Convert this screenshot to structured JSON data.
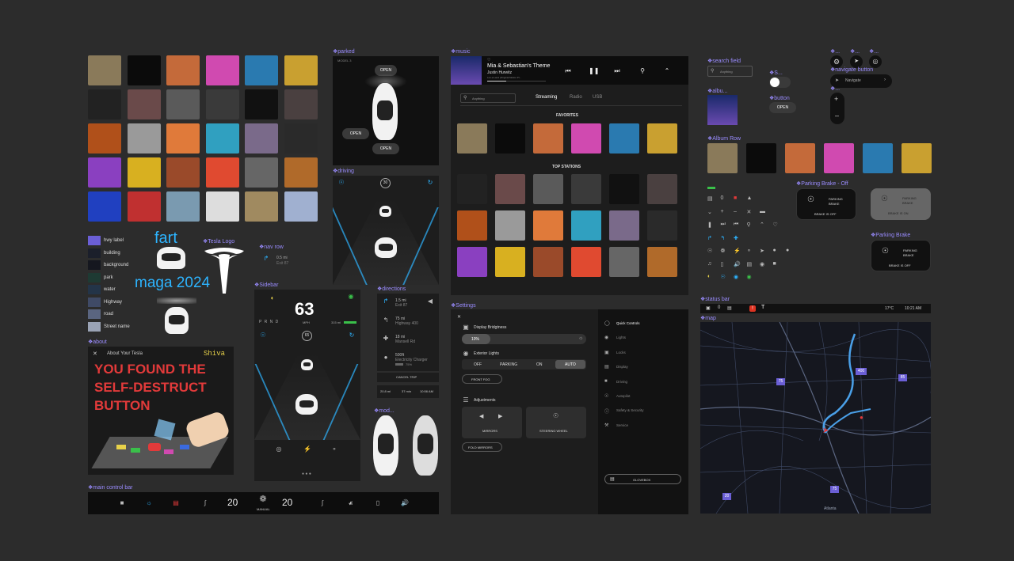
{
  "labels": {
    "parked": "parked",
    "driving": "driving",
    "music": "music",
    "sidebar": "Sidebar",
    "directions": "directions",
    "settings": "Settings",
    "about": "about",
    "main_control_bar": "main control bar",
    "tesla_logo": "Tesla Logo",
    "nav_row": "nav row",
    "modes": "mod...",
    "search_field": "search field",
    "album": "albu...",
    "album_row": "Album Row",
    "switch": "S...",
    "button": "button",
    "navigate_button": "navigate button",
    "parking_brake_off": "Parking Brake - Off",
    "parking_brake": "Parking Brake",
    "status_bar": "status bar",
    "map": "map",
    "dot1": "...",
    "dot2": "...",
    "dot3": "...",
    "dot4": "..."
  },
  "colors": [
    {
      "name": "hwy label",
      "hex": "#6b5fd6"
    },
    {
      "name": "building",
      "hex": "#1b1f2b"
    },
    {
      "name": "background",
      "hex": "#15171f"
    },
    {
      "name": "park",
      "hex": "#1e3a33"
    },
    {
      "name": "water",
      "hex": "#233448"
    },
    {
      "name": "Highway",
      "hex": "#3f4a66"
    },
    {
      "name": "road",
      "hex": "#5a6580"
    },
    {
      "name": "Street name",
      "hex": "#9aa3b5"
    }
  ],
  "misc": {
    "fart": "fart",
    "maga": "maga 2024"
  },
  "nav_row": {
    "dist": "0.5 mi",
    "exit": "Exit 87"
  },
  "parked": {
    "model": "MODEL 3",
    "open_top": "OPEN",
    "open_left": "OPEN",
    "open_bottom": "OPEN"
  },
  "driving": {
    "speed_limit": "30"
  },
  "sidebar": {
    "speed": "63",
    "unit": "MPH",
    "gears": "P R N D",
    "range": "315 mi",
    "limit": "65"
  },
  "directions": {
    "steps": [
      {
        "dist": "1.5 mi",
        "road": "Exit 87"
      },
      {
        "dist": "75 mi",
        "road": "Highway 400"
      },
      {
        "dist": "18 mi",
        "road": "Mansell Rd"
      },
      {
        "dist": "500ft",
        "road": "Electricity Charger",
        "extra": "75%"
      }
    ],
    "cancel": "CANCEL TRIP",
    "footer": {
      "dist": "20.8 mi",
      "time": "37 min",
      "eta": "10:56 AM"
    }
  },
  "music": {
    "title": "Mia & Sebastian's Theme",
    "artist": "Justin Hurwitz",
    "album": "La La Land (Original Motion Pi...",
    "time_start": "1:12",
    "time_end": "3:45",
    "search_placeholder": "Anything",
    "tabs": [
      "Streaming",
      "Radio",
      "USB"
    ],
    "favorites": "FAVORITES",
    "top_stations": "TOP STATIONS"
  },
  "settings": {
    "display_brightness": "Display Bridgtness",
    "brightness_value": "10%",
    "exterior_lights": "Exterior Lights",
    "light_opts": [
      "OFF",
      "PARKING",
      "ON",
      "AUTO"
    ],
    "front_fog": "FRONT FOG",
    "adjustments": "Adjustments",
    "mirrors": "MIRRORS",
    "steering": "STEERING WHEEL",
    "fold": "FOLD MIRRORS",
    "menu": [
      "Quick Controls",
      "Lights",
      "Locks",
      "Display",
      "Driving",
      "Autopilot",
      "Safety & Security",
      "Service"
    ],
    "glovebox": "GLOVEBOX"
  },
  "about": {
    "title": "About Your Tesla",
    "name": "Shiva",
    "headline": "YOU FOUND THE SELF-DESTRUCT BUTTON"
  },
  "control_bar": {
    "temp_left": "20",
    "temp_right": "20",
    "fan_mode": "MANUAL"
  },
  "widgets": {
    "search_placeholder": "Anything",
    "open": "OPEN",
    "navigate": "Navigate",
    "brake_title": "PARKING BRAKE",
    "brake_off": "BRAKE IS OFF",
    "brake_on": "BRAKE IS ON",
    "zero": "0",
    "status_temp": "17°C",
    "status_time": "10:21 AM"
  },
  "map": {
    "shields": [
      "400",
      "75",
      "85",
      "20",
      "75"
    ],
    "city": "Atlanta"
  },
  "album_colors": [
    "#8a7a5a",
    "#0b0b0b",
    "#c46a3a",
    "#d04ab0",
    "#2a7ab0",
    "#c9a030",
    "#222",
    "#6a4a4a",
    "#5a5a5a",
    "#3a3a3a",
    "#111",
    "#4a4040",
    "#b0501a",
    "#9a9a9a",
    "#e07a3a",
    "#30a0c0",
    "#7a6a8a",
    "#2a2a2a",
    "#8a40c0",
    "#d8b020",
    "#9a4a2a",
    "#e04a30",
    "#666",
    "#b06a2a",
    "#2040c0",
    "#c03030",
    "#7a9ab0",
    "#ddd",
    "#a08a60",
    "#a0b0d0"
  ]
}
